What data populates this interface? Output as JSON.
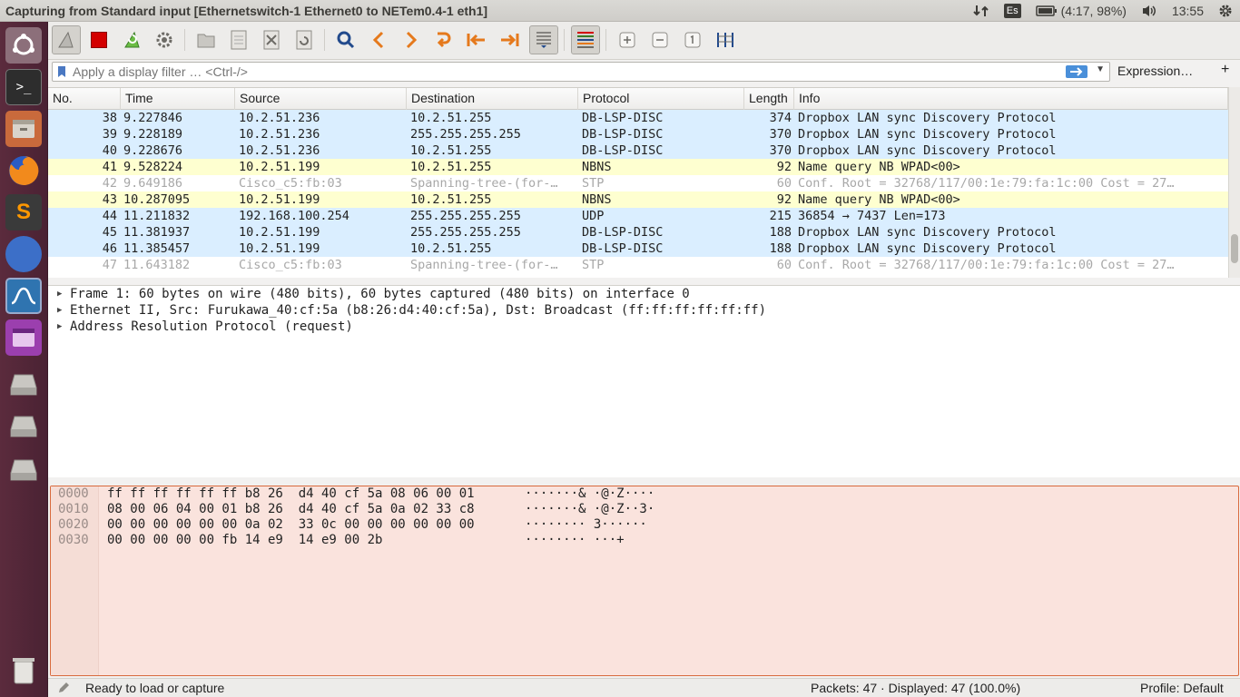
{
  "window": {
    "title": "Capturing from Standard input [Ethernetswitch-1 Ethernet0 to NETem0.4-1 eth1]"
  },
  "tray": {
    "keyboard_layout": "Es",
    "battery": "(4:17, 98%)",
    "clock": "13:55"
  },
  "launcher": {
    "items": [
      "ubuntu-logo-icon",
      "terminal-icon",
      "file-manager-icon",
      "firefox-icon",
      "sublime-text-icon",
      "blue-app-icon",
      "wireshark-icon",
      "purple-app-icon",
      "disk-drive-icon",
      "disk-drive-icon",
      "disk-drive-icon",
      "trash-icon"
    ]
  },
  "filter": {
    "placeholder": "Apply a display filter … <Ctrl-/>",
    "expression_label": "Expression…",
    "add_label": "+"
  },
  "packet_list": {
    "columns": [
      "No.",
      "Time",
      "Source",
      "Destination",
      "Protocol",
      "Length",
      "Info"
    ],
    "rows": [
      {
        "no": "38",
        "time": "9.227846",
        "src": "10.2.51.236",
        "dst": "10.2.51.255",
        "proto": "DB-LSP-DISC",
        "len": "374",
        "info": "Dropbox LAN sync Discovery Protocol",
        "color": "#daeeff",
        "fg": "#222222"
      },
      {
        "no": "39",
        "time": "9.228189",
        "src": "10.2.51.236",
        "dst": "255.255.255.255",
        "proto": "DB-LSP-DISC",
        "len": "370",
        "info": "Dropbox LAN sync Discovery Protocol",
        "color": "#daeeff",
        "fg": "#222222"
      },
      {
        "no": "40",
        "time": "9.228676",
        "src": "10.2.51.236",
        "dst": "10.2.51.255",
        "proto": "DB-LSP-DISC",
        "len": "370",
        "info": "Dropbox LAN sync Discovery Protocol",
        "color": "#daeeff",
        "fg": "#222222"
      },
      {
        "no": "41",
        "time": "9.528224",
        "src": "10.2.51.199",
        "dst": "10.2.51.255",
        "proto": "NBNS",
        "len": "92",
        "info": "Name query NB WPAD<00>",
        "color": "#feffd0",
        "fg": "#222222"
      },
      {
        "no": "42",
        "time": "9.649186",
        "src": "Cisco_c5:fb:03",
        "dst": "Spanning-tree-(for-…",
        "proto": "STP",
        "len": "60",
        "info": "Conf. Root = 32768/117/00:1e:79:fa:1c:00  Cost = 27…",
        "color": "#ffffff",
        "fg": "#a8a8a8"
      },
      {
        "no": "43",
        "time": "10.287095",
        "src": "10.2.51.199",
        "dst": "10.2.51.255",
        "proto": "NBNS",
        "len": "92",
        "info": "Name query NB WPAD<00>",
        "color": "#feffd0",
        "fg": "#222222"
      },
      {
        "no": "44",
        "time": "11.211832",
        "src": "192.168.100.254",
        "dst": "255.255.255.255",
        "proto": "UDP",
        "len": "215",
        "info": "36854 → 7437 Len=173",
        "color": "#daeeff",
        "fg": "#222222"
      },
      {
        "no": "45",
        "time": "11.381937",
        "src": "10.2.51.199",
        "dst": "255.255.255.255",
        "proto": "DB-LSP-DISC",
        "len": "188",
        "info": "Dropbox LAN sync Discovery Protocol",
        "color": "#daeeff",
        "fg": "#222222"
      },
      {
        "no": "46",
        "time": "11.385457",
        "src": "10.2.51.199",
        "dst": "10.2.51.255",
        "proto": "DB-LSP-DISC",
        "len": "188",
        "info": "Dropbox LAN sync Discovery Protocol",
        "color": "#daeeff",
        "fg": "#222222"
      },
      {
        "no": "47",
        "time": "11.643182",
        "src": "Cisco_c5:fb:03",
        "dst": "Spanning-tree-(for-…",
        "proto": "STP",
        "len": "60",
        "info": "Conf. Root = 32768/117/00:1e:79:fa:1c:00  Cost = 27…",
        "color": "#ffffff",
        "fg": "#a8a8a8"
      }
    ]
  },
  "details": [
    "Frame 1: 60 bytes on wire (480 bits), 60 bytes captured (480 bits) on interface 0",
    "Ethernet II, Src: Furukawa_40:cf:5a (b8:26:d4:40:cf:5a), Dst: Broadcast (ff:ff:ff:ff:ff:ff)",
    "Address Resolution Protocol (request)"
  ],
  "bytes": [
    {
      "off": "0000",
      "hex": "ff ff ff ff ff ff b8 26  d4 40 cf 5a 08 06 00 01",
      "ascii": "·······& ·@·Z····"
    },
    {
      "off": "0010",
      "hex": "08 00 06 04 00 01 b8 26  d4 40 cf 5a 0a 02 33 c8",
      "ascii": "·······& ·@·Z··3·"
    },
    {
      "off": "0020",
      "hex": "00 00 00 00 00 00 0a 02  33 0c 00 00 00 00 00 00",
      "ascii": "········ 3······"
    },
    {
      "off": "0030",
      "hex": "00 00 00 00 00 fb 14 e9  14 e9 00 2b",
      "ascii": "········ ···+"
    }
  ],
  "status": {
    "ready": "Ready to load or capture",
    "packets": "Packets: 47 · Displayed: 47 (100.0%)",
    "profile": "Profile: Default"
  },
  "colors": {
    "selected_blue": "#daeeff",
    "nbns_yellow": "#feffd0",
    "bytes_bg": "#fae3dd",
    "launcher": "#4a2233"
  }
}
